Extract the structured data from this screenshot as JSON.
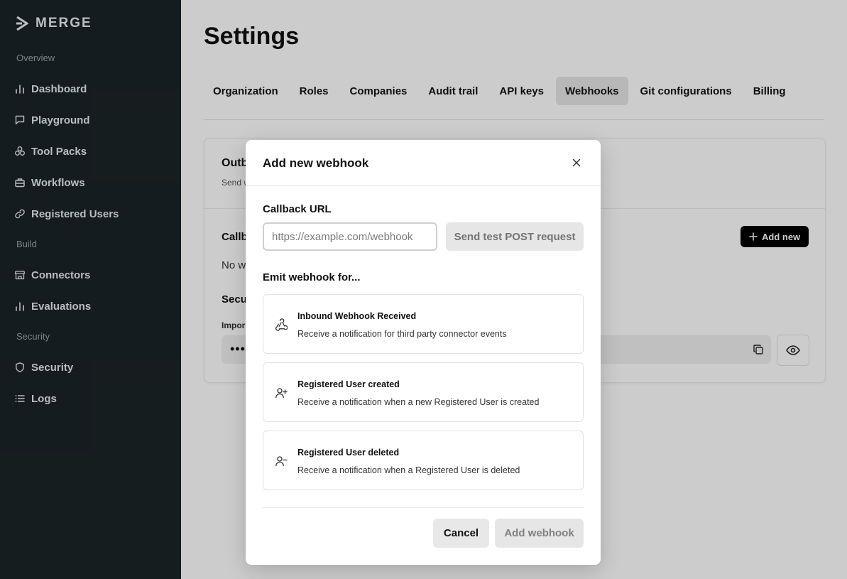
{
  "app": {
    "logo_text": "MERGE"
  },
  "sidebar": {
    "sections": [
      {
        "label": "Overview"
      },
      {
        "label": "Build"
      },
      {
        "label": "Security"
      }
    ],
    "items": [
      {
        "label": "Dashboard",
        "icon": "bar-chart-icon"
      },
      {
        "label": "Playground",
        "icon": "chat-bubble-icon"
      },
      {
        "label": "Tool Packs",
        "icon": "tool-packs-icon"
      },
      {
        "label": "Workflows",
        "icon": "briefcase-icon"
      },
      {
        "label": "Registered Users",
        "icon": "link-icon"
      },
      {
        "label": "Connectors",
        "icon": "store-icon"
      },
      {
        "label": "Evaluations",
        "icon": "bar-chart-icon"
      },
      {
        "label": "Security",
        "icon": "shield-icon"
      },
      {
        "label": "Logs",
        "icon": "list-icon"
      }
    ]
  },
  "page": {
    "title": "Settings",
    "tabs": [
      {
        "label": "Organization",
        "active": false
      },
      {
        "label": "Roles",
        "active": false
      },
      {
        "label": "Companies",
        "active": false
      },
      {
        "label": "Audit trail",
        "active": false
      },
      {
        "label": "API keys",
        "active": false
      },
      {
        "label": "Webhooks",
        "active": true
      },
      {
        "label": "Git configurations",
        "active": false
      },
      {
        "label": "Billing",
        "active": false
      }
    ],
    "card": {
      "title_partial": "Outb",
      "subtitle_partial": "Send w",
      "callback_partial": "Callb",
      "no_webhooks_partial": "No w",
      "security_partial": "Secu",
      "important_partial": "Impor",
      "secret_masked": "•••",
      "add_new_label": "Add new"
    }
  },
  "modal": {
    "title": "Add new webhook",
    "callback_label": "Callback URL",
    "url_value": "",
    "url_placeholder": "https://example.com/webhook",
    "test_button_label": "Send test POST request",
    "emit_label": "Emit webhook for...",
    "options": [
      {
        "title": "Inbound Webhook Received",
        "description": "Receive a notification for third party connector events",
        "icon": "webhook-icon"
      },
      {
        "title": "Registered User created",
        "description": "Receive a notification when a new Registered User is created",
        "icon": "user-plus-icon"
      },
      {
        "title": "Registered User deleted",
        "description": "Receive a notification when a Registered User is deleted",
        "icon": "user-minus-icon"
      }
    ],
    "cancel_label": "Cancel",
    "submit_label": "Add webhook"
  },
  "colors": {
    "sidebar_bg": "#1b2427",
    "primary_button": "#000000",
    "active_tab_bg": "#e6e6e6",
    "disabled_button_bg": "#e6e6e6"
  }
}
